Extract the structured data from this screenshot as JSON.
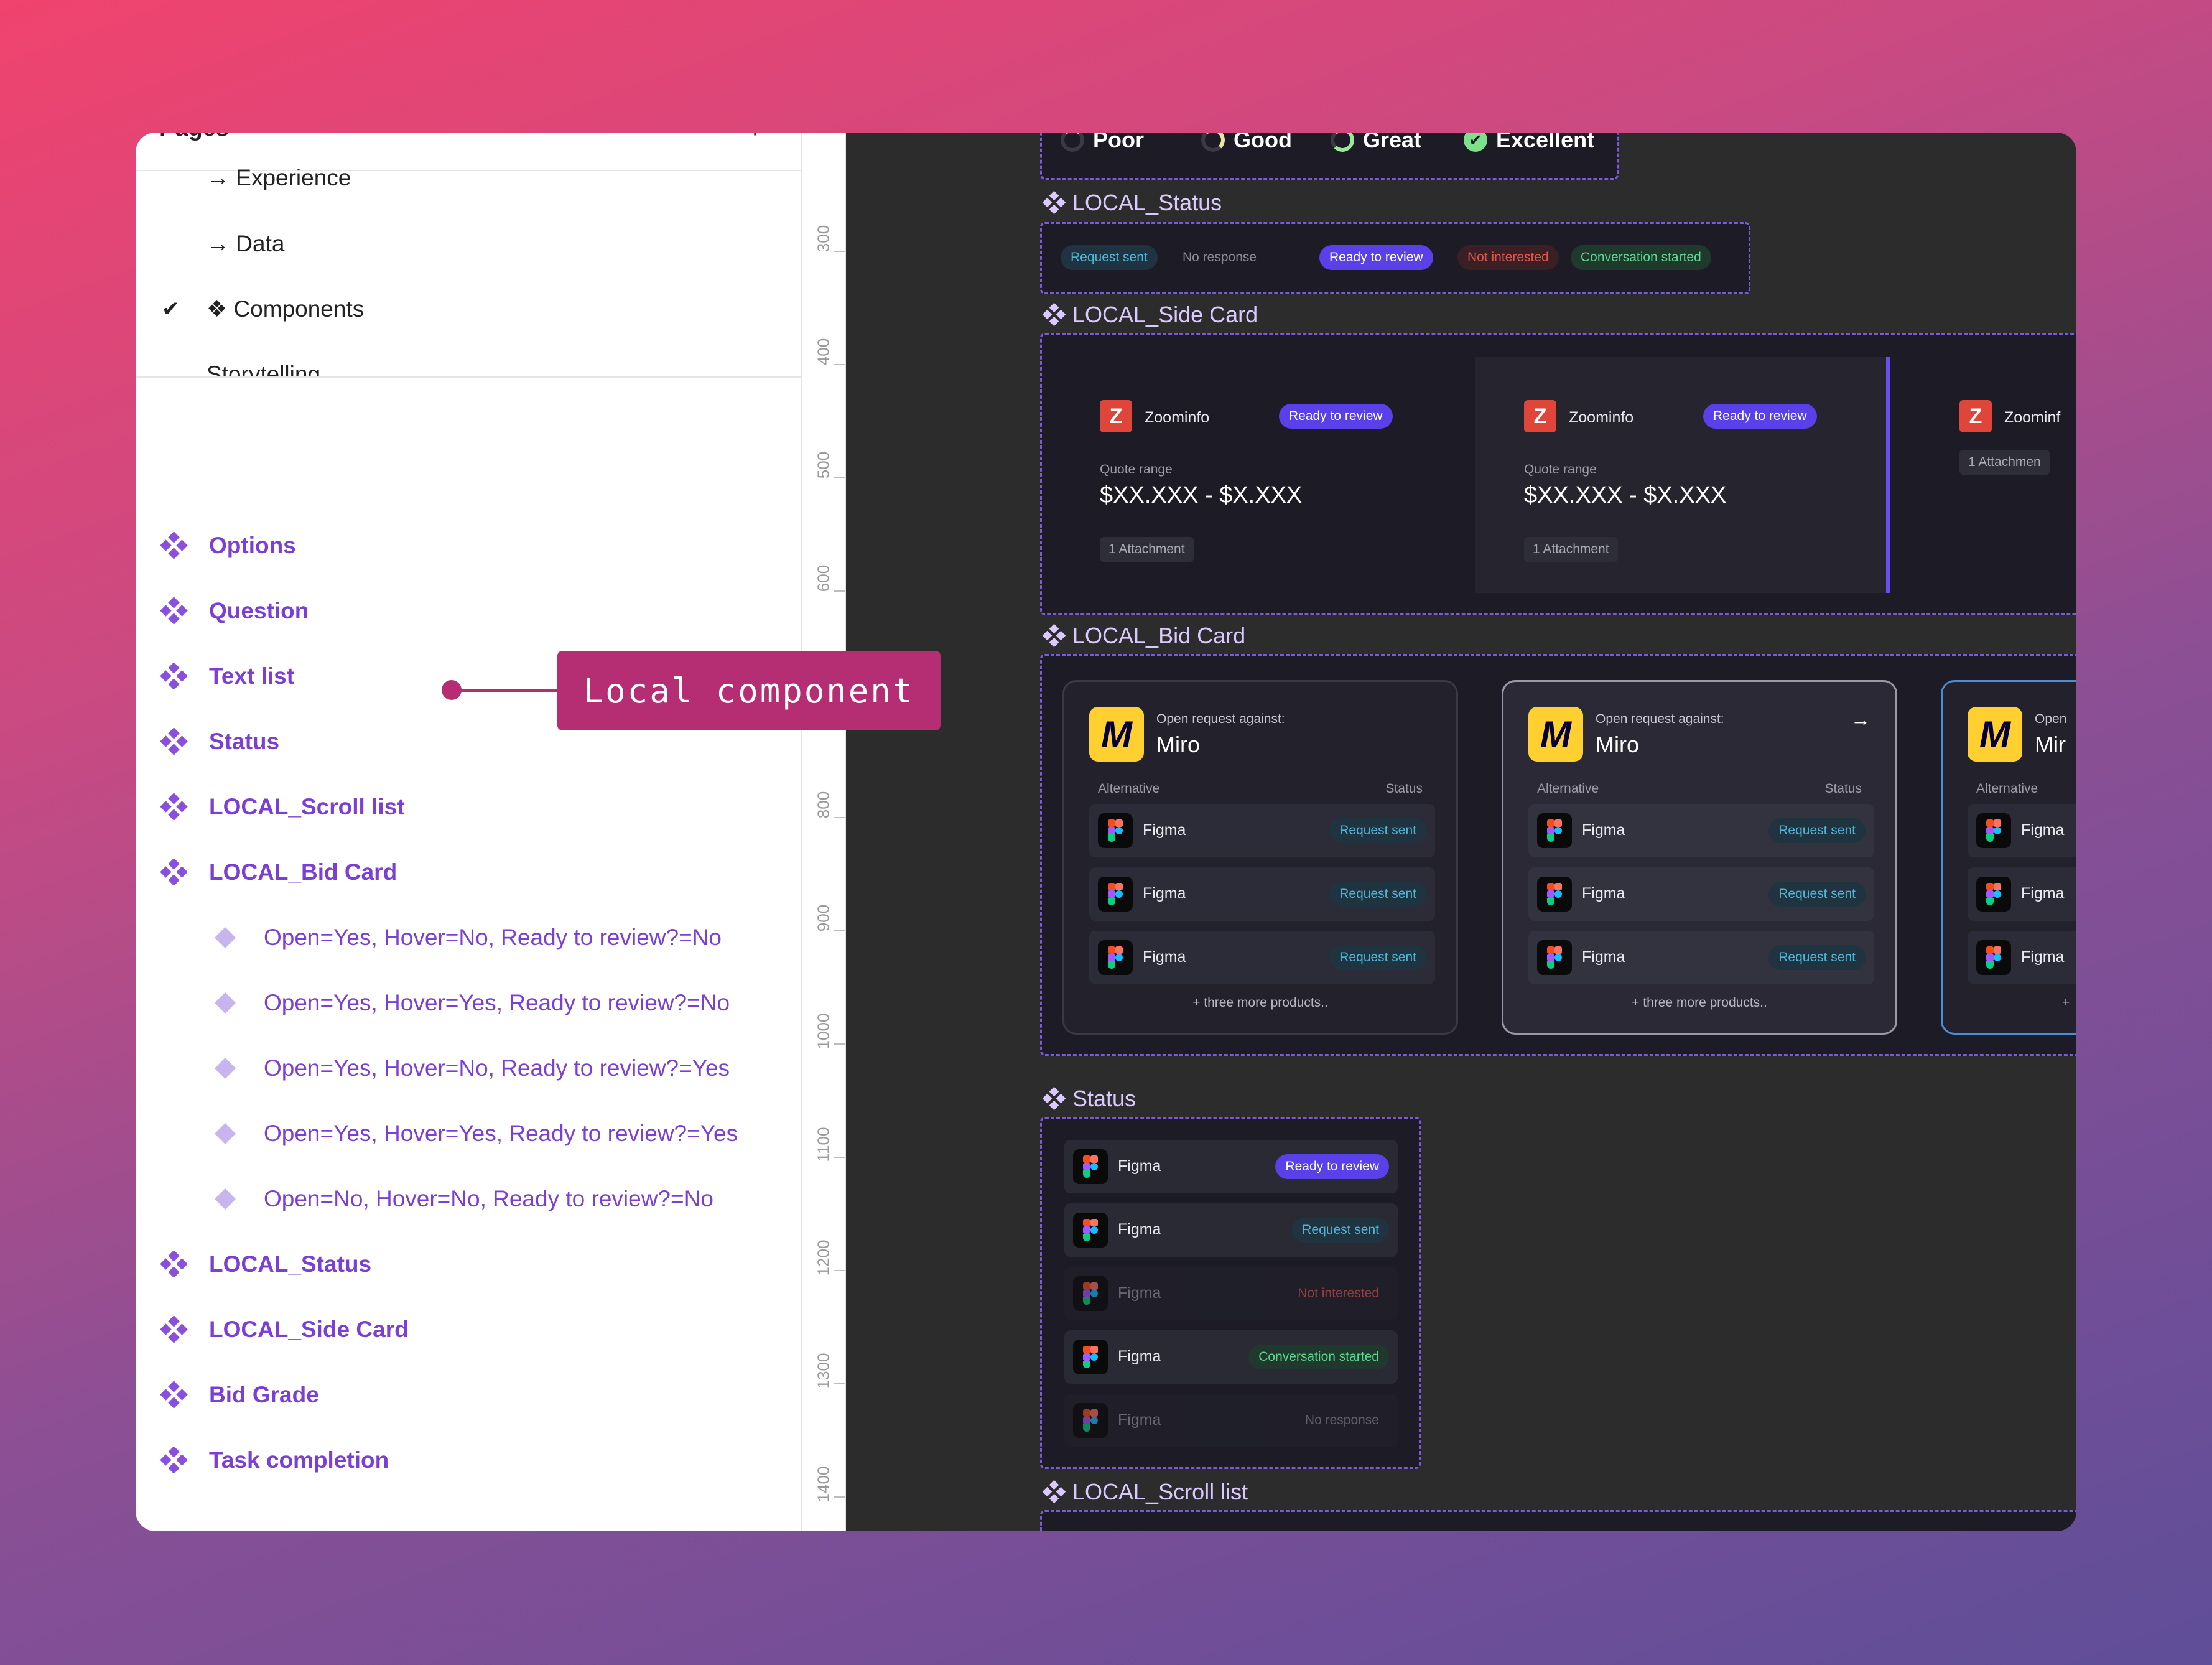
{
  "sidebar": {
    "pages_title": "Pages",
    "pages_plus": "+",
    "pages": [
      {
        "label": "→ Experience"
      },
      {
        "label": "→ Data"
      },
      {
        "label": "❖ Components",
        "current": true
      },
      {
        "label": "Storytelling"
      }
    ],
    "layers": [
      {
        "label": "Options"
      },
      {
        "label": "Question"
      },
      {
        "label": "Text list"
      },
      {
        "label": "Status"
      },
      {
        "label": "LOCAL_Scroll list"
      },
      {
        "label": "LOCAL_Bid Card"
      },
      {
        "label": "Open=Yes, Hover=No, Ready to review?=No"
      },
      {
        "label": "Open=Yes, Hover=Yes, Ready to review?=No"
      },
      {
        "label": "Open=Yes, Hover=No, Ready to review?=Yes"
      },
      {
        "label": "Open=Yes, Hover=Yes, Ready to review?=Yes"
      },
      {
        "label": "Open=No, Hover=No, Ready to review?=No"
      },
      {
        "label": "LOCAL_Status"
      },
      {
        "label": "LOCAL_Side Card"
      },
      {
        "label": "Bid Grade"
      },
      {
        "label": "Task completion"
      }
    ]
  },
  "ruler": {
    "labels": [
      "300",
      "400",
      "500",
      "600",
      "800",
      "900",
      "1000",
      "1100",
      "1200",
      "1300",
      "1400"
    ]
  },
  "callout": {
    "text": "Local component"
  },
  "canvas": {
    "grades": [
      "Poor",
      "Good",
      "Great",
      "Excellent"
    ],
    "frames": {
      "local_status": "LOCAL_Status",
      "side_card": "LOCAL_Side Card",
      "bid_card": "LOCAL_Bid Card",
      "status": "Status",
      "scroll_list": "LOCAL_Scroll list"
    },
    "status_pills": [
      "Request sent",
      "No response",
      "Ready to review",
      "Not interested",
      "Conversation started"
    ],
    "side_card": {
      "company": "Zoominfo",
      "badge": "Ready to review",
      "quote_label": "Quote range",
      "quote_value": "$XX.XXX - $X.XXX",
      "attachment": "1 Attachment",
      "partial_company": "Zoominf",
      "partial_attachment": "1 Attachmen"
    },
    "bid_card": {
      "open_label": "Open request against:",
      "company": "Miro",
      "col_alt": "Alternative",
      "col_status": "Status",
      "row_name": "Figma",
      "row_status": "Request sent",
      "more": "+ three more products..",
      "partial_open": "Open",
      "partial_company": "Mir",
      "partial_more": "+"
    },
    "status_list": [
      {
        "name": "Figma",
        "status": "Ready to review"
      },
      {
        "name": "Figma",
        "status": "Request sent"
      },
      {
        "name": "Figma",
        "status": "Not interested"
      },
      {
        "name": "Figma",
        "status": "Conversation started"
      },
      {
        "name": "Figma",
        "status": "No response"
      }
    ]
  }
}
